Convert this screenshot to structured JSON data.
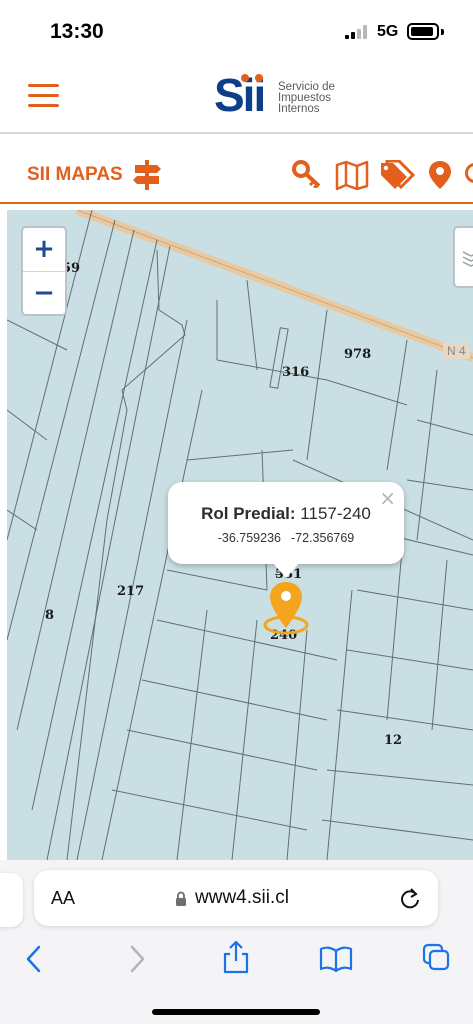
{
  "status_bar": {
    "time": "13:30",
    "network": "5G"
  },
  "header": {
    "logo_mark": "Sii",
    "logo_lines": [
      "Servicio de",
      "Impuestos",
      "Internos"
    ]
  },
  "toolbar": {
    "title": "SII MAPAS",
    "icons": [
      "signpost-icon",
      "key-icon",
      "map-icon",
      "tags-icon",
      "location-pin-icon"
    ]
  },
  "map": {
    "zoom_in": "+",
    "zoom_out": "−",
    "road_label": "N 4",
    "lot_labels": [
      "59",
      "316",
      "978",
      "5̶31",
      "217",
      "8",
      "240",
      "12"
    ],
    "popup": {
      "title_label": "Rol Predial:",
      "title_value": "1157-240",
      "latitude": "-36.759236",
      "longitude": "-72.356769",
      "close": "×"
    }
  },
  "browser": {
    "aa": "AA",
    "url": "www4.sii.cl"
  },
  "colors": {
    "accent": "#e2601c",
    "brand_blue": "#0d3f88",
    "map_bg": "#c9dfe3",
    "marker": "#f4a51c"
  }
}
